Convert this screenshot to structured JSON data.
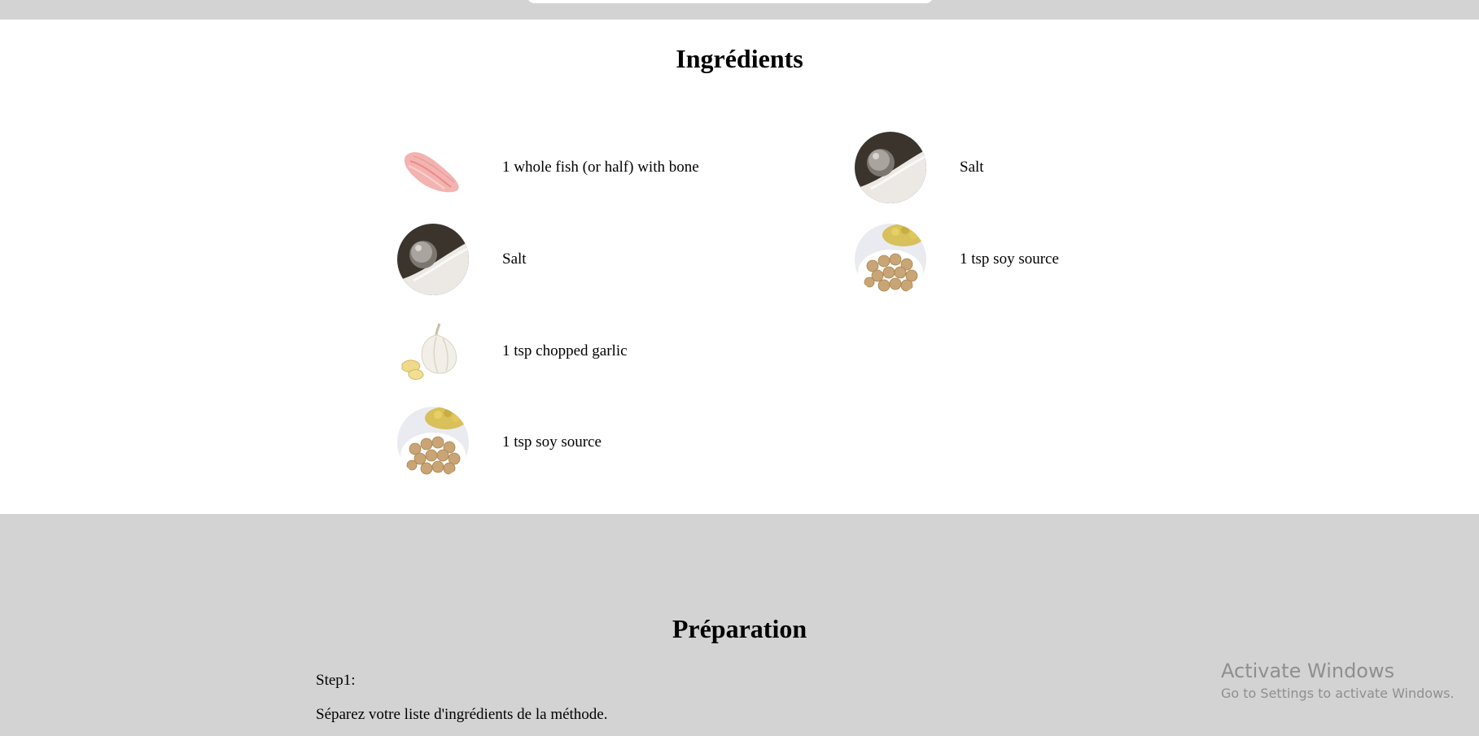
{
  "ingredients": {
    "title": "Ingrédients",
    "items": [
      {
        "label": "1 whole fish (or half) with bone",
        "icon": "fish-fillet-image"
      },
      {
        "label": "Salt",
        "icon": "salt-image"
      },
      {
        "label": "Salt",
        "icon": "salt-image"
      },
      {
        "label": "1 tsp soy source",
        "icon": "soybeans-image"
      },
      {
        "label": "1 tsp chopped garlic",
        "icon": "garlic-image"
      },
      {
        "label": "1 tsp soy source",
        "icon": "soybeans-image"
      }
    ]
  },
  "preparation": {
    "title": "Préparation",
    "step_label": "Step1:",
    "step_text": "Séparez votre liste d'ingrédients de la méthode."
  },
  "watermark": {
    "title": "Activate Windows",
    "subtitle": "Go to Settings to activate Windows."
  },
  "colors": {
    "band_gray": "#d3d3d3",
    "section_white": "#ffffff",
    "watermark_gray": "#8f8f8f"
  }
}
